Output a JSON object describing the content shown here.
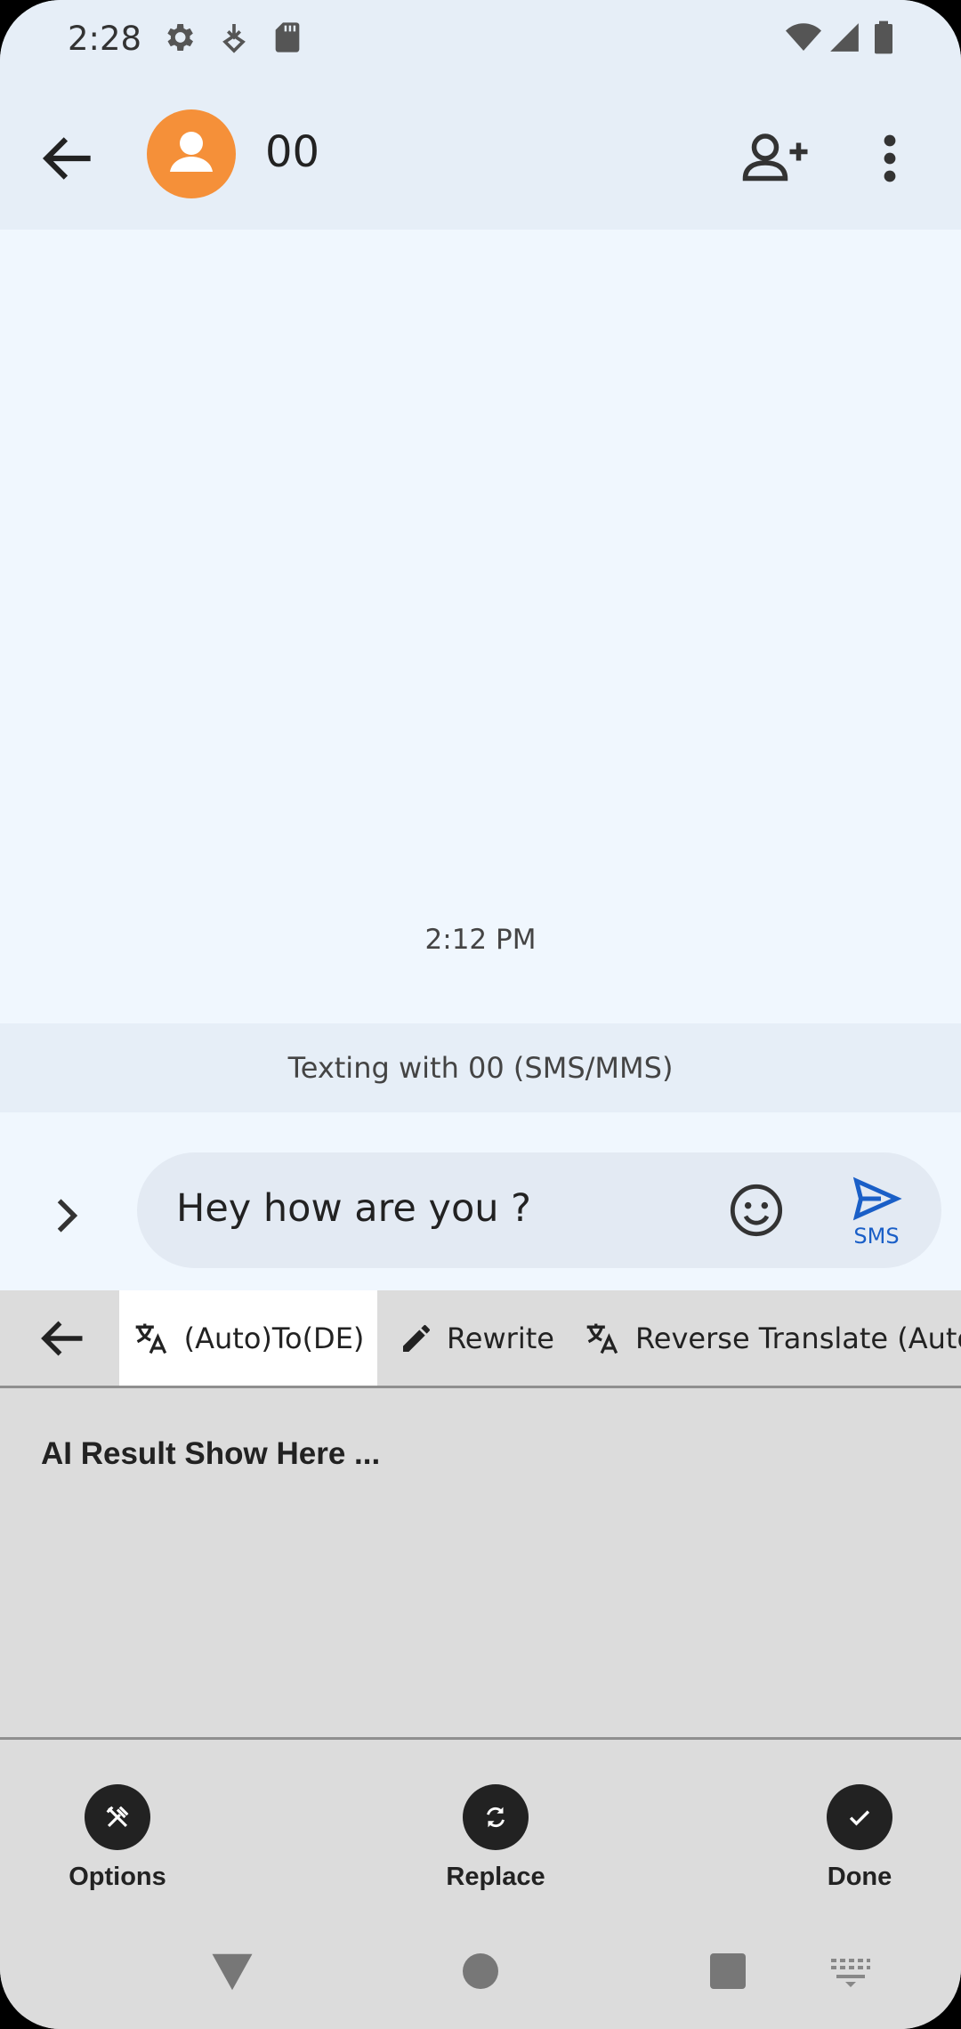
{
  "status_bar": {
    "time": "2:28",
    "left_icons": [
      "settings-icon",
      "download-icon",
      "sd-card-icon"
    ],
    "right_icons": [
      "wifi-icon",
      "signal-icon",
      "battery-icon"
    ]
  },
  "app_bar": {
    "contact_name": "00",
    "avatar_color": "#f59039",
    "actions": [
      "add-contact-icon",
      "more-vert-icon"
    ]
  },
  "conversation": {
    "timestamp": "2:12 PM",
    "texting_with": "Texting with 00 (SMS/MMS)"
  },
  "compose": {
    "input_value": "Hey how are you ?",
    "send_label": "SMS",
    "send_color": "#1a5fc7"
  },
  "ai_panel": {
    "tabs": [
      {
        "label": "(Auto)To(DE)",
        "icon": "translate-icon",
        "active": true
      },
      {
        "label": "Rewrite",
        "icon": "pencil-icon",
        "active": false
      },
      {
        "label": "Reverse Translate (Auto)",
        "icon": "translate-icon",
        "active": false
      }
    ],
    "result_text": "AI Result Show Here ...",
    "actions": [
      {
        "label": "Options",
        "icon": "tools-icon"
      },
      {
        "label": "Replace",
        "icon": "refresh-icon"
      },
      {
        "label": "Done",
        "icon": "check-icon"
      }
    ]
  },
  "nav_bar": {
    "buttons": [
      "back-triangle-icon",
      "home-circle-icon",
      "recents-square-icon",
      "keyboard-icon"
    ]
  }
}
